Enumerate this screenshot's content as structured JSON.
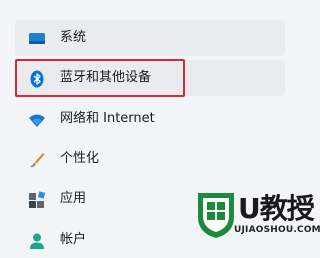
{
  "nav": {
    "items": [
      {
        "label": "系统",
        "icon": "monitor-icon"
      },
      {
        "label": "蓝牙和其他设备",
        "icon": "bluetooth-icon"
      },
      {
        "label": "网络和 Internet",
        "icon": "wifi-icon"
      },
      {
        "label": "个性化",
        "icon": "brush-icon"
      },
      {
        "label": "应用",
        "icon": "apps-icon"
      },
      {
        "label": "帐户",
        "icon": "account-icon"
      }
    ]
  },
  "watermark": {
    "brand": "U教授",
    "url": "UJIAOSHOU.COM"
  },
  "colors": {
    "accent": "#0067c0",
    "highlight": "#d92b2f",
    "watermark_green": "#1b8a3a"
  }
}
